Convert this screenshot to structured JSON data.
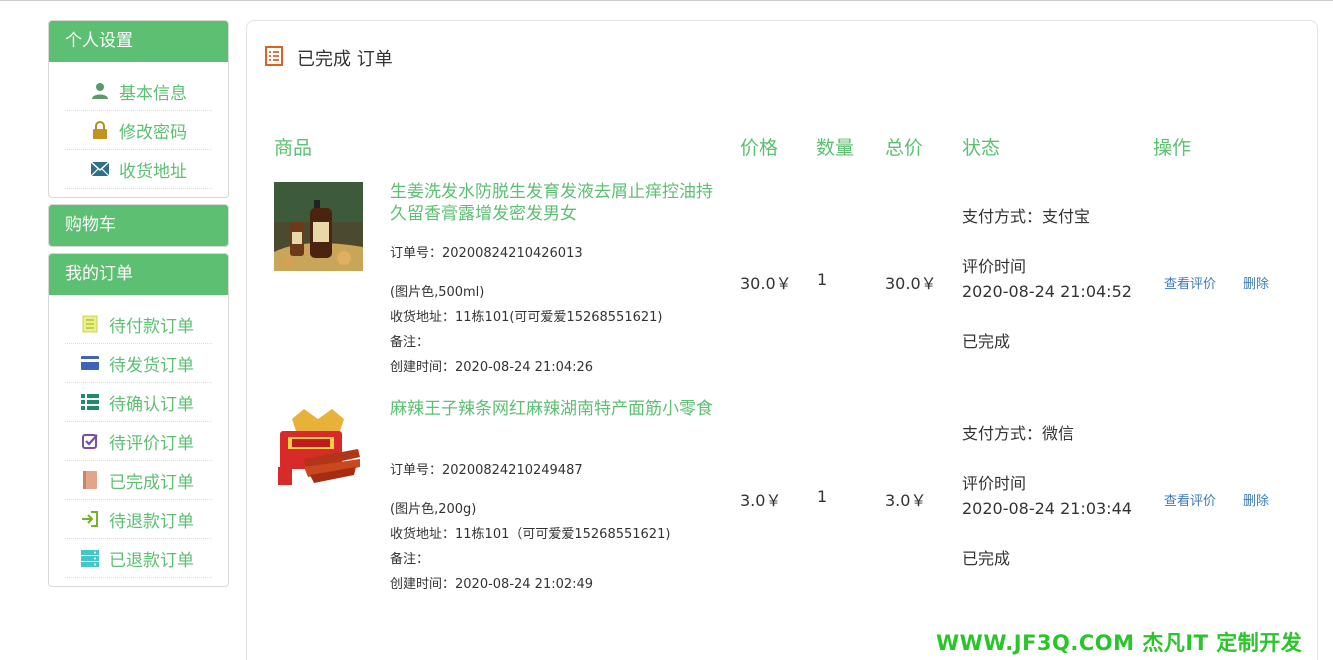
{
  "sidebar": {
    "personal": {
      "title": "个人设置",
      "items": [
        {
          "label": "基本信息",
          "icon": "user-icon"
        },
        {
          "label": "修改密码",
          "icon": "lock-icon"
        },
        {
          "label": "收货地址",
          "icon": "envelope-icon"
        }
      ]
    },
    "cart": {
      "title": "购物车"
    },
    "orders": {
      "title": "我的订单",
      "items": [
        {
          "label": "待付款订单",
          "icon": "list-icon"
        },
        {
          "label": "待发货订单",
          "icon": "card-icon"
        },
        {
          "label": "待确认订单",
          "icon": "bullet-list-icon"
        },
        {
          "label": "待评价订单",
          "icon": "check-square-icon"
        },
        {
          "label": "已完成订单",
          "icon": "book-icon"
        },
        {
          "label": "待退款订单",
          "icon": "sign-in-icon"
        },
        {
          "label": "已退款订单",
          "icon": "server-icon"
        }
      ]
    }
  },
  "main": {
    "title": "已完成 订单",
    "headers": {
      "product": "商品",
      "price": "价格",
      "qty": "数量",
      "total": "总价",
      "status": "状态",
      "action": "操作"
    },
    "orders": [
      {
        "name": "生姜洗发水防脱生发育发液去屑止痒控油持久留香膏露增发密发男女",
        "order_no": "订单号：20200824210426013",
        "spec": "(图片色,500ml)",
        "address": "收货地址：11栋101(可可爱爱15268551621)",
        "note": "备注：",
        "created": "创建时间：2020-08-24 21:04:26",
        "price": "30.0￥",
        "qty": "1",
        "total": "30.0￥",
        "pay": "支付方式：支付宝",
        "review_label": "评价时间",
        "review_time": "2020-08-24 21:04:52",
        "state": "已完成",
        "view_review": "查看评价",
        "delete": "删除"
      },
      {
        "name": "麻辣王子辣条网红麻辣湖南特产面筋小零食",
        "order_no": "订单号：20200824210249487",
        "spec": "(图片色,200g)",
        "address": "收货地址：11栋101（可可爱爱15268551621)",
        "note": "备注：",
        "created": "创建时间：2020-08-24 21:02:49",
        "price": "3.0￥",
        "qty": "1",
        "total": "3.0￥",
        "pay": "支付方式：微信",
        "review_label": "评价时间",
        "review_time": "2020-08-24 21:03:44",
        "state": "已完成",
        "view_review": "查看评价",
        "delete": "删除"
      }
    ]
  },
  "watermark": "WWW.JF3Q.COM 杰凡IT  定制开发",
  "colors": {
    "accent": "#5cbf72",
    "link": "#3d7ab8",
    "watermark": "#2bc42b"
  }
}
